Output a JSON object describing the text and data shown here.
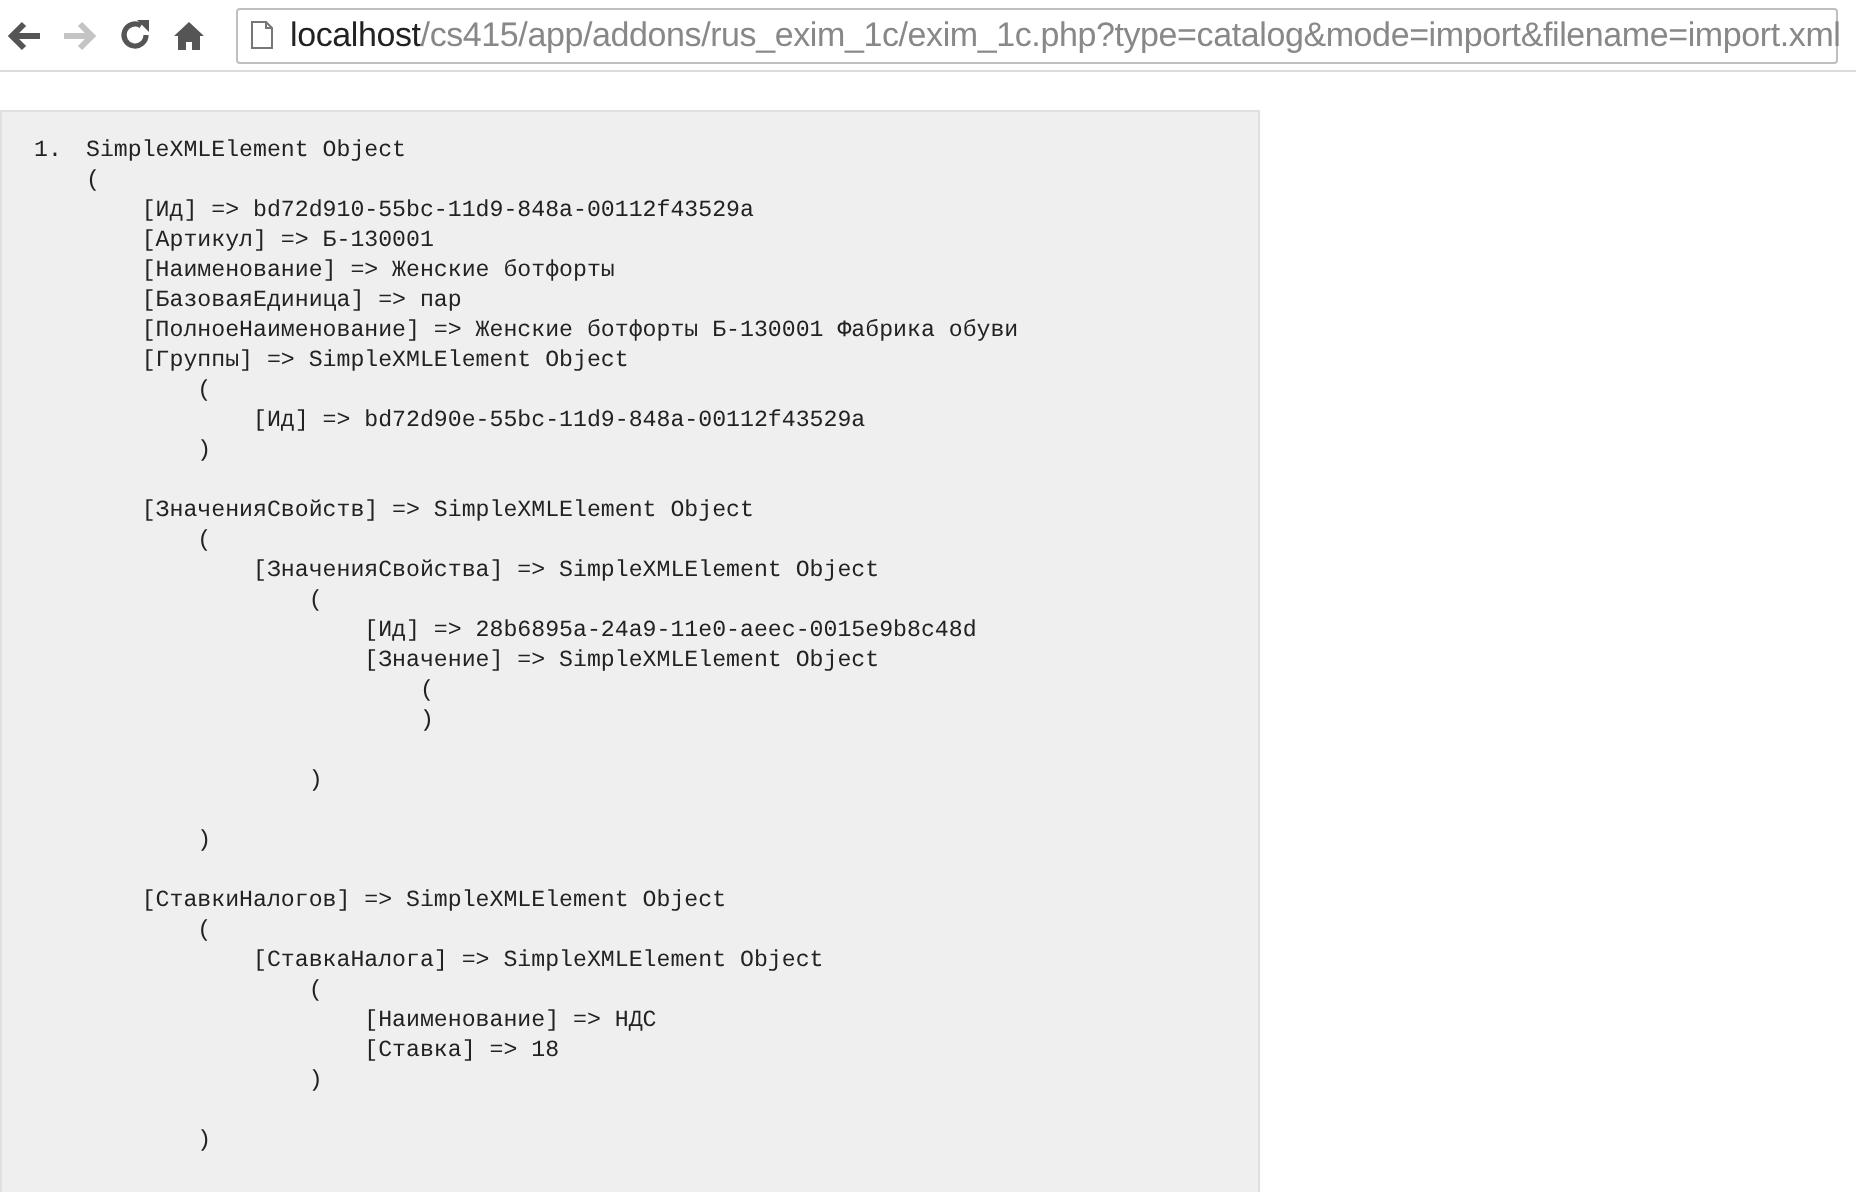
{
  "toolbar": {
    "nav_buttons": [
      {
        "kind": "back",
        "disabled": false
      },
      {
        "kind": "forward",
        "disabled": true
      },
      {
        "kind": "reload",
        "disabled": false
      },
      {
        "kind": "home",
        "disabled": false
      }
    ],
    "address": {
      "host": "localhost",
      "path": "/cs415/app/addons/rus_exim_1c/exim_1c.php?type=catalog&mode=import&filename=import.xml"
    }
  },
  "output": {
    "number": "1.",
    "text": "SimpleXMLElement Object\n(\n    [Ид] => bd72d910-55bc-11d9-848a-00112f43529a\n    [Артикул] => Б-130001\n    [Наименование] => Женские ботфорты\n    [БазоваяЕдиница] => пар\n    [ПолноеНаименование] => Женские ботфорты Б-130001 Фабрика обуви\n    [Группы] => SimpleXMLElement Object\n        (\n            [Ид] => bd72d90e-55bc-11d9-848a-00112f43529a\n        )\n\n    [ЗначенияСвойств] => SimpleXMLElement Object\n        (\n            [ЗначенияСвойства] => SimpleXMLElement Object\n                (\n                    [Ид] => 28b6895a-24a9-11e0-aeec-0015e9b8c48d\n                    [Значение] => SimpleXMLElement Object\n                        (\n                        )\n\n                )\n\n        )\n\n    [СтавкиНалогов] => SimpleXMLElement Object\n        (\n            [СтавкаНалога] => SimpleXMLElement Object\n                (\n                    [Наименование] => НДС\n                    [Ставка] => 18\n                )\n\n        )"
  }
}
